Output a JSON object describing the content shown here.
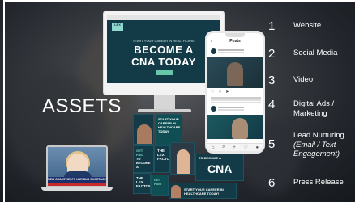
{
  "slide": {
    "title": "ASSETS",
    "items": [
      {
        "num": "1",
        "label": "Website"
      },
      {
        "num": "2",
        "label": "Social Media"
      },
      {
        "num": "3",
        "label": "Video"
      },
      {
        "num": "4",
        "label": "Digital Ads /",
        "label2": "Marketing"
      },
      {
        "num": "5",
        "label": "Lead Nurturing",
        "sub1": "(Email / Text",
        "sub2": "Engagement)"
      },
      {
        "num": "6",
        "label": "Press Release"
      }
    ]
  },
  "website": {
    "logo": "THE LEX FACTOR",
    "tagline": "START YOUR CAREER IN HEALTHCARE",
    "headline1": "BECOME A",
    "headline2": "CNA TODAY"
  },
  "phone": {
    "header": "Posts",
    "back": "‹",
    "nav": [
      "⌂",
      "⌕",
      "+",
      "♡",
      "●"
    ],
    "icons": "♡ ○ ➤"
  },
  "ads": {
    "ad1": "START YOUR CAREER IN HEALTHCARE TODAY",
    "ad2_line1": "GET PAID",
    "ad2_line2": "TO BECOME A",
    "ad2_line3": "CNA",
    "ad3": "THE LEX FACTOR",
    "ad4": "CNA",
    "ad5": "THE LEX FACTOR",
    "ad6": "START YOUR CAREER IN HEALTHCARE TODAY!",
    "ad7": "GET PAID",
    "ad8": "THE LEX FACTOR"
  },
  "laptop": {
    "ticker": "NEW GRANT HELPS NURSING SHORTAGE"
  },
  "colors": {
    "brand_dark": "#123a47",
    "brand_accent": "#67c6a9",
    "background": "#22262c"
  }
}
